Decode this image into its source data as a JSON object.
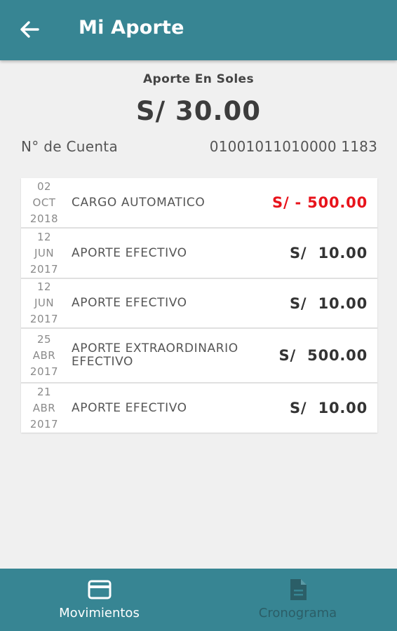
{
  "header": {
    "title": "Mi Aporte",
    "back_icon": "arrow-left-icon"
  },
  "summary": {
    "label": "Aporte En Soles",
    "amount": "S/ 30.00",
    "account_label": "N° de Cuenta",
    "account_number": "01001011010000 1183"
  },
  "movements": [
    {
      "day": "02",
      "month": "OCT",
      "year": "2018",
      "description": "CARGO AUTOMATICO",
      "amount": "S/ - 500.00",
      "negative": true
    },
    {
      "day": "12",
      "month": "JUN",
      "year": "2017",
      "description": "APORTE EFECTIVO",
      "amount": "S/  10.00",
      "negative": false
    },
    {
      "day": "12",
      "month": "JUN",
      "year": "2017",
      "description": "APORTE EFECTIVO",
      "amount": "S/  10.00",
      "negative": false
    },
    {
      "day": "25",
      "month": "ABR",
      "year": "2017",
      "description": "APORTE EXTRAORDINARIO EFECTIVO",
      "amount": "S/  500.00",
      "negative": false
    },
    {
      "day": "21",
      "month": "ABR",
      "year": "2017",
      "description": "APORTE EFECTIVO",
      "amount": "S/  10.00",
      "negative": false
    }
  ],
  "bottom_nav": [
    {
      "label": "Movimientos",
      "icon": "credit-card-icon",
      "active": true
    },
    {
      "label": "Cronograma",
      "icon": "document-icon",
      "active": false
    }
  ],
  "colors": {
    "primary": "#378593",
    "negative_amount": "#e8131b",
    "background": "#f0f0f0"
  }
}
